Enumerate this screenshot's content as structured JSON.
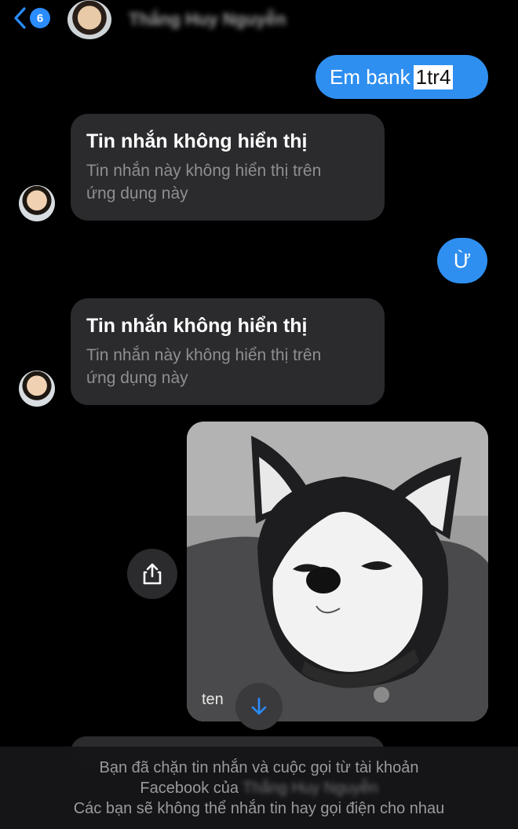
{
  "header": {
    "back_count": "6",
    "contact_name": "Thắng Huy Nguyễn"
  },
  "messages": {
    "m1": {
      "text": "Em bank ",
      "highlight": "1tr4"
    },
    "m2": {
      "title": "Tin nhắn không hiển thị",
      "sub1": "Tin nhắn này không hiển thị trên",
      "sub2": "ứng dụng này"
    },
    "m3": {
      "text": "Ừ"
    },
    "m4": {
      "title": "Tin nhắn không hiển thị",
      "sub1": "Tin nhắn này không hiển thị trên",
      "sub2": "ứng dụng này"
    },
    "image_caption": "ten"
  },
  "footer": {
    "line1": "Bạn đã chặn tin nhắn và cuộc gọi từ tài khoản",
    "line2_prefix": "Facebook của ",
    "line2_name": "Thắng Huy Nguyễn",
    "line3": "Các bạn sẽ không thể nhắn tin hay gọi điện cho nhau"
  },
  "colors": {
    "accent": "#2f8ff0",
    "bubble_incoming": "#2b2b2e",
    "background": "#000000"
  },
  "icons": {
    "back": "chevron-left-icon",
    "share": "share-icon",
    "download": "arrow-down-icon"
  }
}
